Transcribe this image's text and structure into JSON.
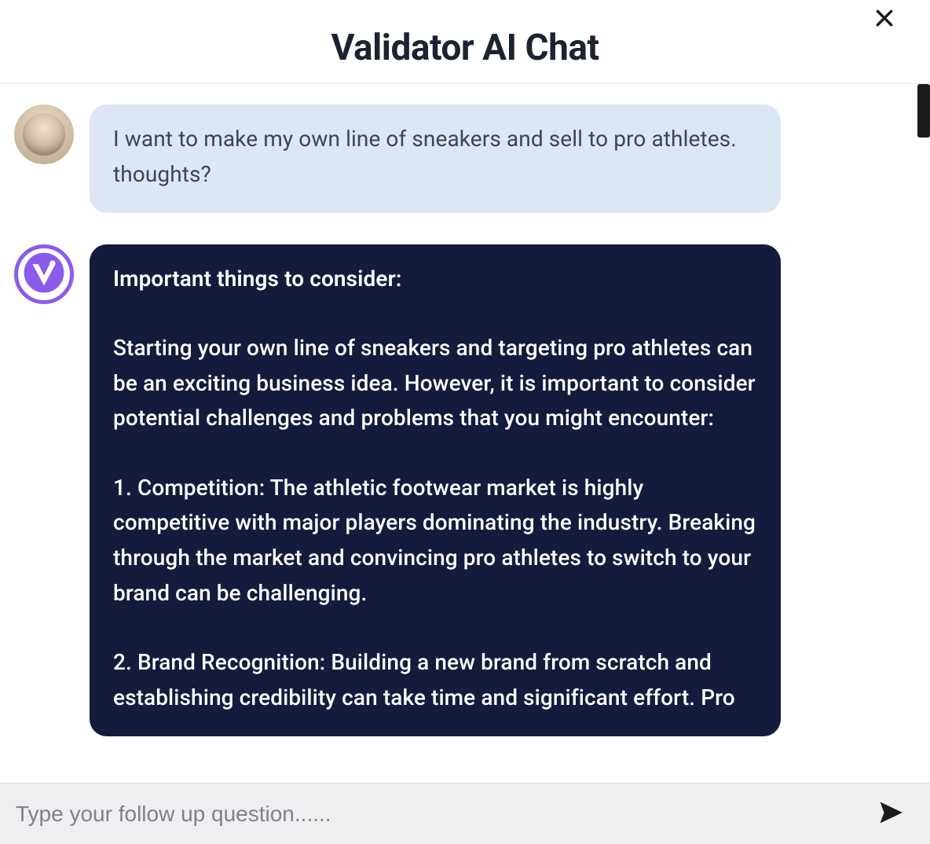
{
  "header": {
    "title": "Validator AI Chat"
  },
  "icons": {
    "close": "close-icon",
    "send": "send-icon",
    "user_avatar": "user-avatar",
    "ai_avatar": "validator-ai-logo"
  },
  "colors": {
    "user_bubble_bg": "#dbe7f4",
    "ai_bubble_bg": "#141b3c",
    "ai_accent": "#8c5bea"
  },
  "chat": {
    "user_message": "I want to make my own line of sneakers and sell to pro athletes. thoughts?",
    "ai_message": {
      "heading": "Important things to consider:",
      "intro": "Starting your own line of sneakers and targeting pro athletes can be an exciting business idea. However, it is important to consider potential challenges and problems that you might encounter:",
      "point1": "1. Competition: The athletic footwear market is highly competitive with major players dominating the industry. Breaking through the market and convincing pro athletes to switch to your brand can be challenging.",
      "point2": "2. Brand Recognition: Building a new brand from scratch and establishing credibility can take time and significant effort. Pro"
    }
  },
  "composer": {
    "placeholder": "Type your follow up question......",
    "value": ""
  }
}
